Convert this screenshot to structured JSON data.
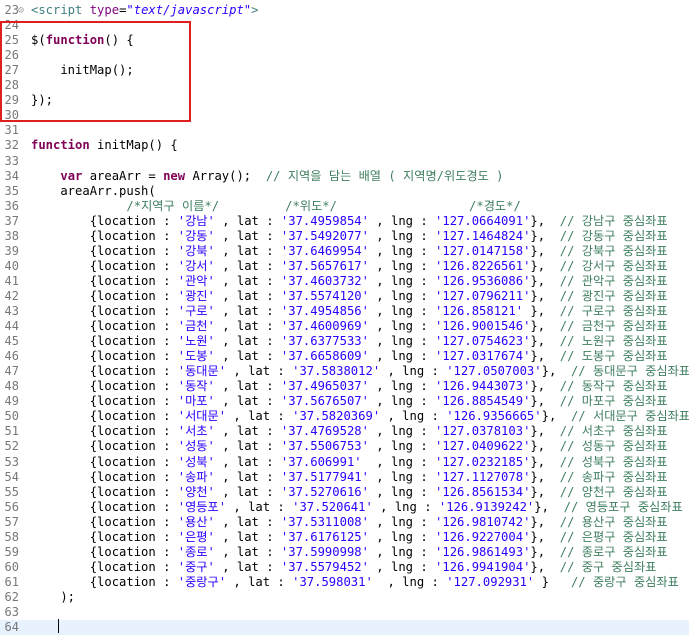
{
  "lines": [
    {
      "n": "23",
      "fold": true,
      "segs": [
        {
          "t": "<script ",
          "c": "tag"
        },
        {
          "t": "type",
          "c": "attr"
        },
        {
          "t": "=",
          "c": ""
        },
        {
          "t": "\"text/javascript\"",
          "c": "attrval"
        },
        {
          "t": ">",
          "c": "tag"
        }
      ]
    },
    {
      "n": "24",
      "segs": []
    },
    {
      "n": "25",
      "segs": [
        {
          "t": "$(",
          "c": ""
        },
        {
          "t": "function",
          "c": "kw"
        },
        {
          "t": "() {",
          "c": ""
        }
      ]
    },
    {
      "n": "26",
      "segs": []
    },
    {
      "n": "27",
      "segs": [
        {
          "t": "    initMap();",
          "c": ""
        }
      ]
    },
    {
      "n": "28",
      "segs": []
    },
    {
      "n": "29",
      "segs": [
        {
          "t": "});",
          "c": ""
        }
      ]
    },
    {
      "n": "30",
      "segs": []
    },
    {
      "n": "31",
      "segs": []
    },
    {
      "n": "32",
      "segs": [
        {
          "t": "function",
          "c": "kw"
        },
        {
          "t": " initMap() {",
          "c": ""
        }
      ]
    },
    {
      "n": "33",
      "segs": []
    },
    {
      "n": "34",
      "segs": [
        {
          "t": "    ",
          "c": ""
        },
        {
          "t": "var",
          "c": "kw"
        },
        {
          "t": " areaArr = ",
          "c": ""
        },
        {
          "t": "new",
          "c": "kw"
        },
        {
          "t": " Array();  ",
          "c": ""
        },
        {
          "t": "// 지역을 담는 배열 ( 지역명/위도경도 )",
          "c": "cm"
        }
      ]
    },
    {
      "n": "35",
      "segs": [
        {
          "t": "    areaArr.push(",
          "c": ""
        }
      ]
    },
    {
      "n": "36",
      "segs": [
        {
          "t": "             ",
          "c": ""
        },
        {
          "t": "/*지역구 이름*/         /*위도*/                  /*경도*/",
          "c": "cm"
        }
      ]
    },
    {
      "n": "37",
      "segs": [
        {
          "t": "        {location : ",
          "c": ""
        },
        {
          "t": "'강남'",
          "c": "str"
        },
        {
          "t": " , lat : ",
          "c": ""
        },
        {
          "t": "'37.4959854'",
          "c": "str"
        },
        {
          "t": " , lng : ",
          "c": ""
        },
        {
          "t": "'127.0664091'",
          "c": "str"
        },
        {
          "t": "},  ",
          "c": ""
        },
        {
          "t": "// 강남구 중심좌표",
          "c": "cm"
        }
      ]
    },
    {
      "n": "38",
      "segs": [
        {
          "t": "        {location : ",
          "c": ""
        },
        {
          "t": "'강동'",
          "c": "str"
        },
        {
          "t": " , lat : ",
          "c": ""
        },
        {
          "t": "'37.5492077'",
          "c": "str"
        },
        {
          "t": " , lng : ",
          "c": ""
        },
        {
          "t": "'127.1464824'",
          "c": "str"
        },
        {
          "t": "},  ",
          "c": ""
        },
        {
          "t": "// 강동구 중심좌표",
          "c": "cm"
        }
      ]
    },
    {
      "n": "39",
      "segs": [
        {
          "t": "        {location : ",
          "c": ""
        },
        {
          "t": "'강북'",
          "c": "str"
        },
        {
          "t": " , lat : ",
          "c": ""
        },
        {
          "t": "'37.6469954'",
          "c": "str"
        },
        {
          "t": " , lng : ",
          "c": ""
        },
        {
          "t": "'127.0147158'",
          "c": "str"
        },
        {
          "t": "},  ",
          "c": ""
        },
        {
          "t": "// 강북구 중심좌표",
          "c": "cm"
        }
      ]
    },
    {
      "n": "40",
      "segs": [
        {
          "t": "        {location : ",
          "c": ""
        },
        {
          "t": "'강서'",
          "c": "str"
        },
        {
          "t": " , lat : ",
          "c": ""
        },
        {
          "t": "'37.5657617'",
          "c": "str"
        },
        {
          "t": " , lng : ",
          "c": ""
        },
        {
          "t": "'126.8226561'",
          "c": "str"
        },
        {
          "t": "},  ",
          "c": ""
        },
        {
          "t": "// 강서구 중심좌표",
          "c": "cm"
        }
      ]
    },
    {
      "n": "41",
      "segs": [
        {
          "t": "        {location : ",
          "c": ""
        },
        {
          "t": "'관악'",
          "c": "str"
        },
        {
          "t": " , lat : ",
          "c": ""
        },
        {
          "t": "'37.4603732'",
          "c": "str"
        },
        {
          "t": " , lng : ",
          "c": ""
        },
        {
          "t": "'126.9536086'",
          "c": "str"
        },
        {
          "t": "},  ",
          "c": ""
        },
        {
          "t": "// 관악구 중심좌표",
          "c": "cm"
        }
      ]
    },
    {
      "n": "42",
      "segs": [
        {
          "t": "        {location : ",
          "c": ""
        },
        {
          "t": "'광진'",
          "c": "str"
        },
        {
          "t": " , lat : ",
          "c": ""
        },
        {
          "t": "'37.5574120'",
          "c": "str"
        },
        {
          "t": " , lng : ",
          "c": ""
        },
        {
          "t": "'127.0796211'",
          "c": "str"
        },
        {
          "t": "},  ",
          "c": ""
        },
        {
          "t": "// 광진구 중심좌표",
          "c": "cm"
        }
      ]
    },
    {
      "n": "43",
      "segs": [
        {
          "t": "        {location : ",
          "c": ""
        },
        {
          "t": "'구로'",
          "c": "str"
        },
        {
          "t": " , lat : ",
          "c": ""
        },
        {
          "t": "'37.4954856'",
          "c": "str"
        },
        {
          "t": " , lng : ",
          "c": ""
        },
        {
          "t": "'126.858121'",
          "c": "str"
        },
        {
          "t": " },  ",
          "c": ""
        },
        {
          "t": "// 구로구 중심좌표",
          "c": "cm"
        }
      ]
    },
    {
      "n": "44",
      "segs": [
        {
          "t": "        {location : ",
          "c": ""
        },
        {
          "t": "'금천'",
          "c": "str"
        },
        {
          "t": " , lat : ",
          "c": ""
        },
        {
          "t": "'37.4600969'",
          "c": "str"
        },
        {
          "t": " , lng : ",
          "c": ""
        },
        {
          "t": "'126.9001546'",
          "c": "str"
        },
        {
          "t": "},  ",
          "c": ""
        },
        {
          "t": "// 금천구 중심좌표",
          "c": "cm"
        }
      ]
    },
    {
      "n": "45",
      "segs": [
        {
          "t": "        {location : ",
          "c": ""
        },
        {
          "t": "'노원'",
          "c": "str"
        },
        {
          "t": " , lat : ",
          "c": ""
        },
        {
          "t": "'37.6377533'",
          "c": "str"
        },
        {
          "t": " , lng : ",
          "c": ""
        },
        {
          "t": "'127.0754623'",
          "c": "str"
        },
        {
          "t": "},  ",
          "c": ""
        },
        {
          "t": "// 노원구 중심좌표",
          "c": "cm"
        }
      ]
    },
    {
      "n": "46",
      "segs": [
        {
          "t": "        {location : ",
          "c": ""
        },
        {
          "t": "'도봉'",
          "c": "str"
        },
        {
          "t": " , lat : ",
          "c": ""
        },
        {
          "t": "'37.6658609'",
          "c": "str"
        },
        {
          "t": " , lng : ",
          "c": ""
        },
        {
          "t": "'127.0317674'",
          "c": "str"
        },
        {
          "t": "},  ",
          "c": ""
        },
        {
          "t": "// 도봉구 중심좌표",
          "c": "cm"
        }
      ]
    },
    {
      "n": "47",
      "segs": [
        {
          "t": "        {location : ",
          "c": ""
        },
        {
          "t": "'동대문'",
          "c": "str"
        },
        {
          "t": " , lat : ",
          "c": ""
        },
        {
          "t": "'37.5838012'",
          "c": "str"
        },
        {
          "t": " , lng : ",
          "c": ""
        },
        {
          "t": "'127.0507003'",
          "c": "str"
        },
        {
          "t": "},  ",
          "c": ""
        },
        {
          "t": "// 동대문구 중심좌표",
          "c": "cm"
        }
      ]
    },
    {
      "n": "48",
      "segs": [
        {
          "t": "        {location : ",
          "c": ""
        },
        {
          "t": "'동작'",
          "c": "str"
        },
        {
          "t": " , lat : ",
          "c": ""
        },
        {
          "t": "'37.4965037'",
          "c": "str"
        },
        {
          "t": " , lng : ",
          "c": ""
        },
        {
          "t": "'126.9443073'",
          "c": "str"
        },
        {
          "t": "},  ",
          "c": ""
        },
        {
          "t": "// 동작구 중심좌표",
          "c": "cm"
        }
      ]
    },
    {
      "n": "49",
      "segs": [
        {
          "t": "        {location : ",
          "c": ""
        },
        {
          "t": "'마포'",
          "c": "str"
        },
        {
          "t": " , lat : ",
          "c": ""
        },
        {
          "t": "'37.5676507'",
          "c": "str"
        },
        {
          "t": " , lng : ",
          "c": ""
        },
        {
          "t": "'126.8854549'",
          "c": "str"
        },
        {
          "t": "},  ",
          "c": ""
        },
        {
          "t": "// 마포구 중심좌표",
          "c": "cm"
        }
      ]
    },
    {
      "n": "50",
      "segs": [
        {
          "t": "        {location : ",
          "c": ""
        },
        {
          "t": "'서대문'",
          "c": "str"
        },
        {
          "t": " , lat : ",
          "c": ""
        },
        {
          "t": "'37.5820369'",
          "c": "str"
        },
        {
          "t": " , lng : ",
          "c": ""
        },
        {
          "t": "'126.9356665'",
          "c": "str"
        },
        {
          "t": "},  ",
          "c": ""
        },
        {
          "t": "// 서대문구 중심좌표",
          "c": "cm"
        }
      ]
    },
    {
      "n": "51",
      "segs": [
        {
          "t": "        {location : ",
          "c": ""
        },
        {
          "t": "'서초'",
          "c": "str"
        },
        {
          "t": " , lat : ",
          "c": ""
        },
        {
          "t": "'37.4769528'",
          "c": "str"
        },
        {
          "t": " , lng : ",
          "c": ""
        },
        {
          "t": "'127.0378103'",
          "c": "str"
        },
        {
          "t": "},  ",
          "c": ""
        },
        {
          "t": "// 서초구 중심좌표",
          "c": "cm"
        }
      ]
    },
    {
      "n": "52",
      "segs": [
        {
          "t": "        {location : ",
          "c": ""
        },
        {
          "t": "'성동'",
          "c": "str"
        },
        {
          "t": " , lat : ",
          "c": ""
        },
        {
          "t": "'37.5506753'",
          "c": "str"
        },
        {
          "t": " , lng : ",
          "c": ""
        },
        {
          "t": "'127.0409622'",
          "c": "str"
        },
        {
          "t": "},  ",
          "c": ""
        },
        {
          "t": "// 성동구 중심좌표",
          "c": "cm"
        }
      ]
    },
    {
      "n": "53",
      "segs": [
        {
          "t": "        {location : ",
          "c": ""
        },
        {
          "t": "'성북'",
          "c": "str"
        },
        {
          "t": " , lat : ",
          "c": ""
        },
        {
          "t": "'37.606991'",
          "c": "str"
        },
        {
          "t": "  , lng : ",
          "c": ""
        },
        {
          "t": "'127.0232185'",
          "c": "str"
        },
        {
          "t": "},  ",
          "c": ""
        },
        {
          "t": "// 성북구 중심좌표",
          "c": "cm"
        }
      ]
    },
    {
      "n": "54",
      "segs": [
        {
          "t": "        {location : ",
          "c": ""
        },
        {
          "t": "'송파'",
          "c": "str"
        },
        {
          "t": " , lat : ",
          "c": ""
        },
        {
          "t": "'37.5177941'",
          "c": "str"
        },
        {
          "t": " , lng : ",
          "c": ""
        },
        {
          "t": "'127.1127078'",
          "c": "str"
        },
        {
          "t": "},  ",
          "c": ""
        },
        {
          "t": "// 송파구 중심좌표",
          "c": "cm"
        }
      ]
    },
    {
      "n": "55",
      "segs": [
        {
          "t": "        {location : ",
          "c": ""
        },
        {
          "t": "'양천'",
          "c": "str"
        },
        {
          "t": " , lat : ",
          "c": ""
        },
        {
          "t": "'37.5270616'",
          "c": "str"
        },
        {
          "t": " , lng : ",
          "c": ""
        },
        {
          "t": "'126.8561534'",
          "c": "str"
        },
        {
          "t": "},  ",
          "c": ""
        },
        {
          "t": "// 양천구 중심좌표",
          "c": "cm"
        }
      ]
    },
    {
      "n": "56",
      "segs": [
        {
          "t": "        {location : ",
          "c": ""
        },
        {
          "t": "'영등포'",
          "c": "str"
        },
        {
          "t": " , lat : ",
          "c": ""
        },
        {
          "t": "'37.520641'",
          "c": "str"
        },
        {
          "t": " , lng : ",
          "c": ""
        },
        {
          "t": "'126.9139242'",
          "c": "str"
        },
        {
          "t": "},  ",
          "c": ""
        },
        {
          "t": "// 영등포구 중심좌표",
          "c": "cm"
        }
      ]
    },
    {
      "n": "57",
      "segs": [
        {
          "t": "        {location : ",
          "c": ""
        },
        {
          "t": "'용산'",
          "c": "str"
        },
        {
          "t": " , lat : ",
          "c": ""
        },
        {
          "t": "'37.5311008'",
          "c": "str"
        },
        {
          "t": " , lng : ",
          "c": ""
        },
        {
          "t": "'126.9810742'",
          "c": "str"
        },
        {
          "t": "},  ",
          "c": ""
        },
        {
          "t": "// 용산구 중심좌표",
          "c": "cm"
        }
      ]
    },
    {
      "n": "58",
      "segs": [
        {
          "t": "        {location : ",
          "c": ""
        },
        {
          "t": "'은평'",
          "c": "str"
        },
        {
          "t": " , lat : ",
          "c": ""
        },
        {
          "t": "'37.6176125'",
          "c": "str"
        },
        {
          "t": " , lng : ",
          "c": ""
        },
        {
          "t": "'126.9227004'",
          "c": "str"
        },
        {
          "t": "},  ",
          "c": ""
        },
        {
          "t": "// 은평구 중심좌표",
          "c": "cm"
        }
      ]
    },
    {
      "n": "59",
      "segs": [
        {
          "t": "        {location : ",
          "c": ""
        },
        {
          "t": "'종로'",
          "c": "str"
        },
        {
          "t": " , lat : ",
          "c": ""
        },
        {
          "t": "'37.5990998'",
          "c": "str"
        },
        {
          "t": " , lng : ",
          "c": ""
        },
        {
          "t": "'126.9861493'",
          "c": "str"
        },
        {
          "t": "},  ",
          "c": ""
        },
        {
          "t": "// 종로구 중심좌표",
          "c": "cm"
        }
      ]
    },
    {
      "n": "60",
      "segs": [
        {
          "t": "        {location : ",
          "c": ""
        },
        {
          "t": "'중구'",
          "c": "str"
        },
        {
          "t": " , lat : ",
          "c": ""
        },
        {
          "t": "'37.5579452'",
          "c": "str"
        },
        {
          "t": " , lng : ",
          "c": ""
        },
        {
          "t": "'126.9941904'",
          "c": "str"
        },
        {
          "t": "},  ",
          "c": ""
        },
        {
          "t": "// 중구 중심좌표",
          "c": "cm"
        }
      ]
    },
    {
      "n": "61",
      "segs": [
        {
          "t": "        {location : ",
          "c": ""
        },
        {
          "t": "'중랑구'",
          "c": "str"
        },
        {
          "t": " , lat : ",
          "c": ""
        },
        {
          "t": "'37.598031'",
          "c": "str"
        },
        {
          "t": "  , lng : ",
          "c": ""
        },
        {
          "t": "'127.092931'",
          "c": "str"
        },
        {
          "t": " }   ",
          "c": ""
        },
        {
          "t": "// 중랑구 중심좌표",
          "c": "cm"
        }
      ]
    },
    {
      "n": "62",
      "segs": [
        {
          "t": "    );",
          "c": ""
        }
      ]
    },
    {
      "n": "63",
      "segs": []
    },
    {
      "n": "64",
      "current": true,
      "segs": []
    }
  ]
}
